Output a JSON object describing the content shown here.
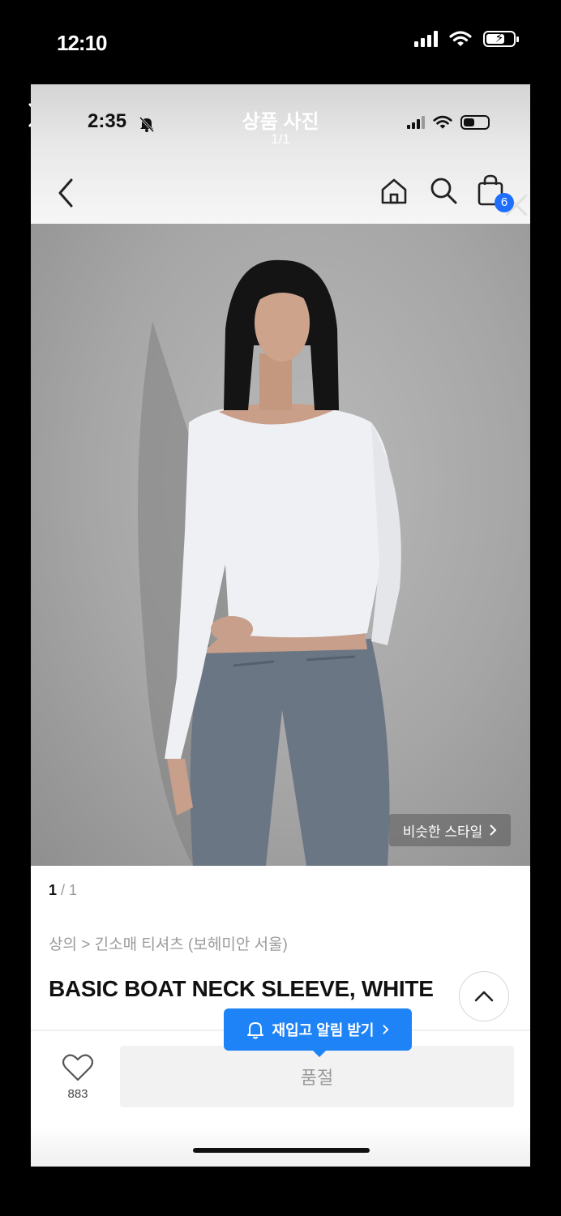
{
  "outer_status": {
    "time": "12:10"
  },
  "viewer": {
    "inner_time": "2:35",
    "title": "상품 사진",
    "subtitle": "1/1"
  },
  "nav": {
    "cart_count": "6"
  },
  "photo": {
    "similar_style_label": "비슷한 스타일"
  },
  "image_counter": {
    "current": "1",
    "total": "1"
  },
  "product": {
    "breadcrumb": "상의 > 긴소매 티셔츠 (보헤미안 서울)",
    "title": "BASIC BOAT NECK SLEEVE, WHITE"
  },
  "restock_alert": {
    "label": "재입고 알림 받기"
  },
  "bottom_bar": {
    "like_count": "883",
    "status_button_label": "품절"
  },
  "colors": {
    "accent_blue": "#1e83f7",
    "badge_blue": "#1f6fff",
    "photo_background": "#a9a9a9"
  }
}
